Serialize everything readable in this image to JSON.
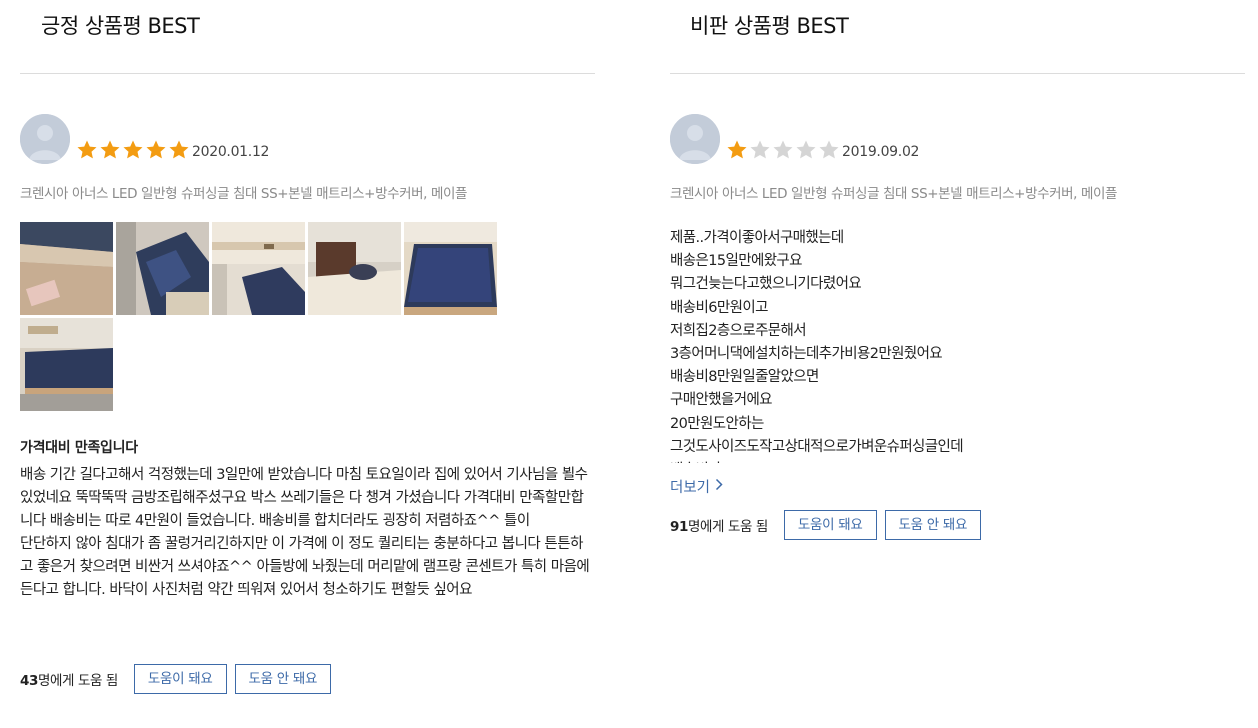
{
  "positive": {
    "section_title": "긍정 상품평 BEST",
    "rating": 5,
    "date": "2020.01.12",
    "product": "크렌시아 아너스 LED 일반형 슈퍼싱글 침대 SS+본넬 매트리스+방수커버, 메이플",
    "review_title": "가격대비 만족입니다",
    "review_paragraphs": [
      "배송 기간 길다고해서 걱정했는데 3일만에 받았습니다 마침 토요일이라 집에 있어서 기사님을 뵐수 있었네요 뚝딱뚝딱 금방조립해주셨구요 박스 쓰레기들은 다 챙겨 가셨습니다 가격대비 만족할만합니다 배송비는 따로 4만원이 들었습니다. 배송비를 합치더라도 굉장히 저렴하죠^^ 틀이",
      "단단하지 않아 침대가 좀 꿀렁거리긴하지만 이 가격에 이 정도 퀄리티는 충분하다고 봅니다 튼튼하고 좋은거 찾으려면 비싼거 쓰셔야죠^^ 아들방에 놔줬는데 머리맡에 램프랑 콘센트가 특히 마음에 든다고 합니다. 바닥이 사진처럼 약간 띄워져 있어서 청소하기도 편할듯 싶어요"
    ],
    "helpful_count": "43",
    "helpful_suffix": "명에게 도움 됨",
    "helpful_yes": "도움이 돼요",
    "helpful_no": "도움 안 돼요"
  },
  "negative": {
    "section_title": "비판 상품평 BEST",
    "rating": 1,
    "date": "2019.09.02",
    "product": "크렌시아 아너스 LED 일반형 슈퍼싱글 침대 SS+본넬 매트리스+방수커버, 메이플",
    "review_lines": [
      "제품..가격이좋아서구매했는데",
      "배송은15일만에왔구요",
      "뭐그건늦는다고했으니기다렸어요",
      "배송비6만원이고",
      "저희집2층으로주문해서",
      "3층어머니댁에설치하는데추가비용2만원줬어요",
      "배송비8만원일줄알았으면",
      "구매안했을거에요",
      "20만원도안하는",
      "그것도사이즈도작고상대적으로가벼운슈퍼싱글인데",
      "배송비가"
    ],
    "more_label": "더보기",
    "helpful_count": "91",
    "helpful_suffix": "명에게 도움 됨",
    "helpful_yes": "도움이 돼요",
    "helpful_no": "도움 안 돼요"
  },
  "colors": {
    "star_filled": "#f39c12",
    "star_empty": "#d5d5d5",
    "link_blue": "#3d6aa8",
    "avatar": "#c3ccd9"
  },
  "icons": {
    "avatar": "user-avatar-icon",
    "star": "star-icon",
    "more": "chevron-right-icon"
  }
}
